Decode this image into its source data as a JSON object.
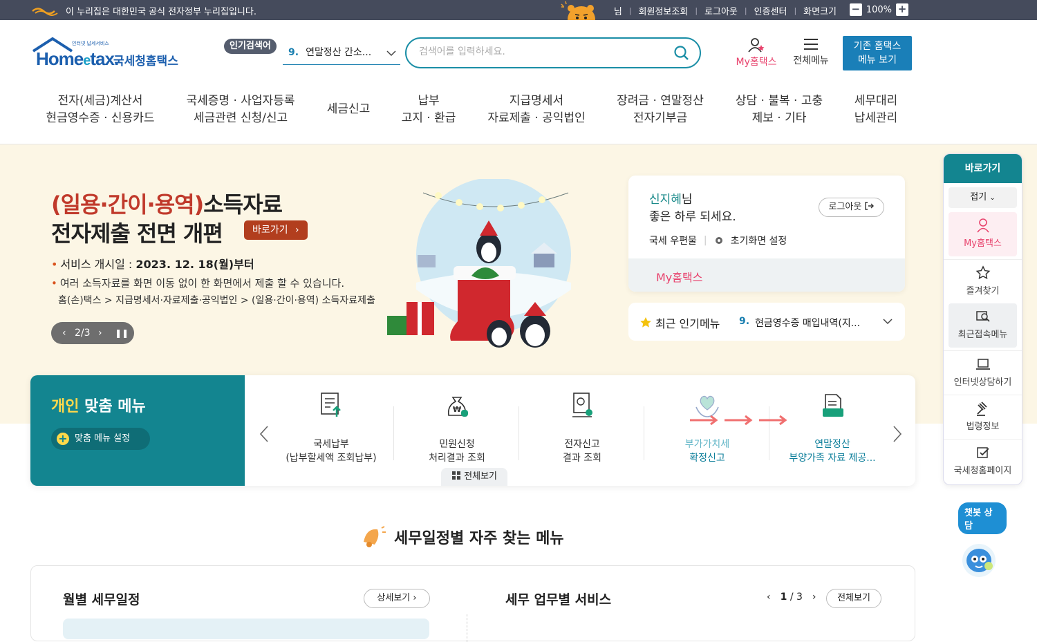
{
  "govbar": {
    "notice": "이 누리집은 대한민국 공식 전자정부 누리집입니다.",
    "user_suffix": "님",
    "links": [
      "회원정보조회",
      "로그아웃",
      "인증센터",
      "화면크기"
    ],
    "zoom": "100%"
  },
  "header": {
    "logo_main": "Home",
    "logo_e": "e",
    "logo_tax": "tax.",
    "logo_kr": "국세청홈택스",
    "logo_tiny": "인터넷 납세서비스",
    "popular_label": "인기검색어",
    "popular_num": "9.",
    "popular_text": "연말정산 간소...",
    "search_placeholder": "검색어를 입력하세요.",
    "my_hometax": "My홈택스",
    "all_menu": "전체메뉴",
    "old_menu_1": "기존 홈택스",
    "old_menu_2": "메뉴 보기"
  },
  "gnb": [
    {
      "l1": "전자(세금)계산서",
      "l2": "현금영수증 · 신용카드"
    },
    {
      "l1": "국세증명 · 사업자등록",
      "l2": "세금관련 신청/신고"
    },
    {
      "l1": "세금신고",
      "l2": ""
    },
    {
      "l1": "납부",
      "l2": "고지 · 환급"
    },
    {
      "l1": "지급명세서",
      "l2": "자료제출 · 공익법인"
    },
    {
      "l1": "장려금 · 연말정산",
      "l2": "전자기부금"
    },
    {
      "l1": "상담 · 불복 · 고충",
      "l2": "제보 · 기타"
    },
    {
      "l1": "세무대리",
      "l2": "납세관리"
    }
  ],
  "hero": {
    "title_red": "(일용·간이·용역)",
    "title_rest": "소득자료",
    "title2": "전자제출 전면 개편",
    "go_label": "바로가기",
    "bullet1_label": "서비스 개시일 : ",
    "bullet1_value": "2023. 12. 18(월)부터",
    "bullet2": "여러 소득자료를 화면 이동 없이 한 화면에서 제출 할 수 있습니다.",
    "path": "홈(손)택스 > 지급명세서·자료제출·공익법인 > (일용·간이·용역) 소득자료제출",
    "slide": "2/3"
  },
  "login": {
    "name": "신지혜",
    "name_suffix": "님",
    "greeting": "좋은 하루 되세요.",
    "logout": "로그아웃",
    "mailbox": "국세 우편물",
    "reset": "초기화면 설정",
    "my_hometax": "My홈택스"
  },
  "recent": {
    "label": "최근 인기메뉴",
    "num": "9.",
    "text": "현금영수증 매입내역(지..."
  },
  "custom_menu": {
    "title_yellow": "개인",
    "title_rest": " 맞춤 메뉴",
    "setting": "맞춤 메뉴 설정",
    "view_all": "전체보기",
    "items": [
      {
        "l1": "국세납부",
        "l2": "(납부할세액 조회납부)"
      },
      {
        "l1": "민원신청",
        "l2": "처리결과 조회"
      },
      {
        "l1": "전자신고",
        "l2": "결과 조회"
      },
      {
        "l1": "부가가치세",
        "l2": "확정신고"
      },
      {
        "l1": "연말정산",
        "l2": "부양가족 자료 제공..."
      }
    ]
  },
  "quick": {
    "title": "바로가기",
    "fold": "접기",
    "items": [
      "My홈택스",
      "즐겨찾기",
      "최근접속메뉴",
      "인터넷상담하기",
      "법령정보",
      "국세청홈페이지"
    ]
  },
  "chatbot": "챗봇 상담",
  "schedule": {
    "title": "세무일정별 자주 찾는 메뉴",
    "monthly": "월별 세무일정",
    "detail": "상세보기",
    "service": "세무 업무별 서비스",
    "page_current": "1",
    "page_total": "/ 3",
    "view_all": "전체보기"
  },
  "colors": {
    "teal": "#138590",
    "pink": "#e8436d",
    "blue": "#1a7fb8",
    "brick": "#b23e1e"
  }
}
